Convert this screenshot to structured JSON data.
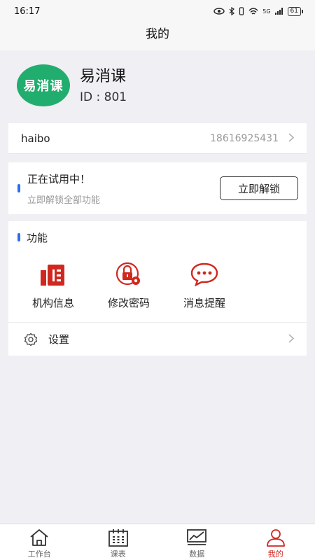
{
  "status": {
    "time": "16:17",
    "network": "5G",
    "battery": "61"
  },
  "header": {
    "title": "我的"
  },
  "profile": {
    "logo_text": "易消课",
    "app_name": "易消课",
    "id_text": "ID : 801"
  },
  "user": {
    "name": "haibo",
    "phone": "18616925431"
  },
  "trial": {
    "title": "正在试用中！",
    "subtitle": "立即解锁全部功能",
    "unlock_label": "立即解锁"
  },
  "features": {
    "title": "功能",
    "items": [
      {
        "label": "机构信息",
        "icon": "building-icon"
      },
      {
        "label": "修改密码",
        "icon": "lock-gear-icon"
      },
      {
        "label": "消息提醒",
        "icon": "chat-bubble-icon"
      }
    ]
  },
  "settings": {
    "label": "设置"
  },
  "tabs": [
    {
      "label": "工作台",
      "icon": "home-icon",
      "active": false
    },
    {
      "label": "课表",
      "icon": "calendar-icon",
      "active": false
    },
    {
      "label": "数据",
      "icon": "chart-icon",
      "active": false
    },
    {
      "label": "我的",
      "icon": "user-icon",
      "active": true
    }
  ],
  "colors": {
    "accent": "#d0281f",
    "brand_green": "#21ad6e",
    "blue_marker": "#2a6ff0",
    "background": "#efeff4"
  }
}
